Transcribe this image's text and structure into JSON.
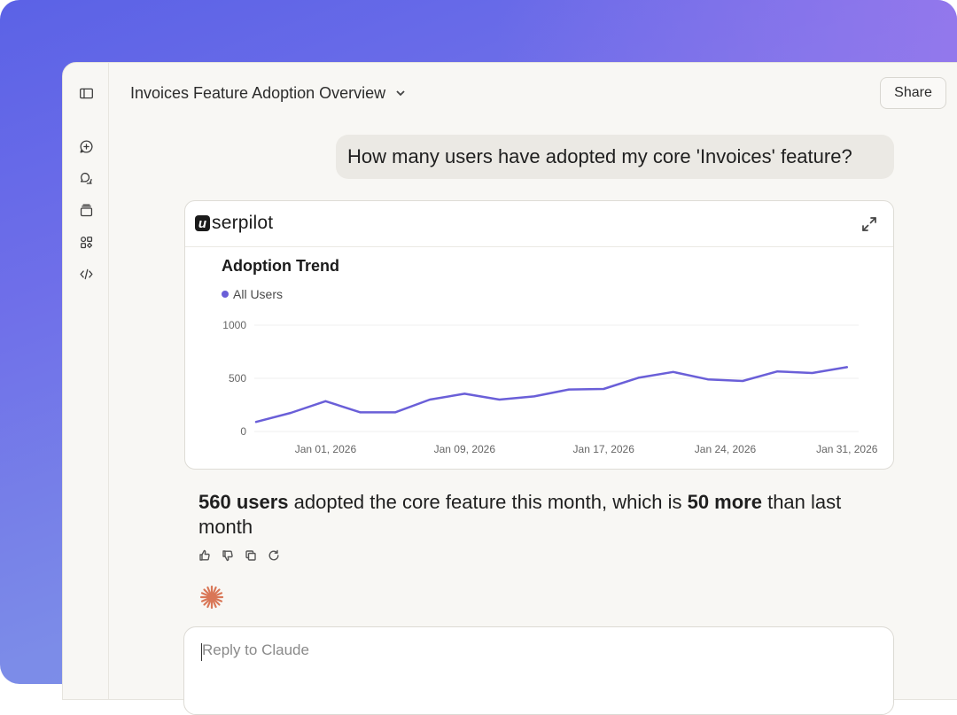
{
  "header": {
    "title": "Invoices Feature Adoption Overview",
    "share_label": "Share"
  },
  "sidebar": {
    "icons": [
      "sidebar-toggle-icon",
      "new-chat-icon",
      "chats-icon",
      "projects-icon",
      "artifacts-icon",
      "code-icon"
    ]
  },
  "conversation": {
    "user_message": "How many users have adopted my core 'Invoices' feature?",
    "artifact": {
      "brand_mark": "u",
      "brand_text": "serpilot",
      "expand_icon": "expand-icon"
    },
    "answer": {
      "part1": "560 users",
      "part2": " adopted the core feature this month, which is ",
      "part3": "50 more",
      "part4": " than last month"
    },
    "response_actions": [
      "thumbs-up-icon",
      "thumbs-down-icon",
      "copy-icon",
      "retry-icon"
    ]
  },
  "composer": {
    "placeholder": "Reply to Claude"
  },
  "colors": {
    "accent": "#6a5fd8",
    "claude_spark": "#d97757"
  },
  "chart_data": {
    "type": "line",
    "title": "Adoption Trend",
    "series": [
      {
        "name": "All Users",
        "values": [
          90,
          175,
          285,
          180,
          180,
          300,
          355,
          300,
          330,
          395,
          400,
          505,
          560,
          490,
          475,
          565,
          550,
          605
        ]
      }
    ],
    "x": [
      "2025-12-28",
      "2025-12-30",
      "2026-01-01",
      "2026-01-03",
      "2026-01-05",
      "2026-01-07",
      "2026-01-09",
      "2026-01-11",
      "2026-01-13",
      "2026-01-15",
      "2026-01-17",
      "2026-01-19",
      "2026-01-21",
      "2026-01-23",
      "2026-01-25",
      "2026-01-27",
      "2026-01-29",
      "2026-01-31"
    ],
    "xticks": [
      "Jan 01, 2026",
      "Jan 09, 2026",
      "Jan 17, 2026",
      "Jan 24, 2026",
      "Jan 31, 2026"
    ],
    "yticks": [
      "0",
      "500",
      "1000"
    ],
    "ylim": [
      0,
      1000
    ],
    "grid": true,
    "legend_position": "top-left"
  }
}
